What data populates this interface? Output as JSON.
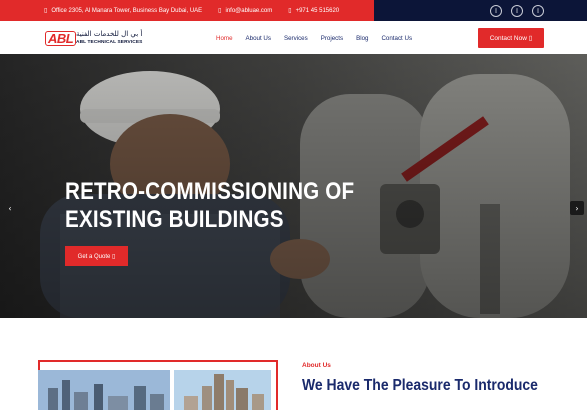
{
  "topbar": {
    "address": "Office 2305, Al Manara Tower, Business Bay Dubai, UAE",
    "email": "info@abluae.com",
    "phone": "+971 45 515620",
    "address_icon": "map-pin-icon",
    "email_icon": "envelope-icon",
    "phone_icon": "phone-icon",
    "social": [
      "facebook-icon",
      "linkedin-icon",
      "instagram-icon"
    ],
    "colors": {
      "left": "#e12a2a",
      "right": "#0c1538"
    }
  },
  "header": {
    "logo_mark": "ABL",
    "logo_arabic": "أ بي ال للخدمات الفنية",
    "logo_english": "ABL TECHNICAL SERVICES",
    "nav": [
      "Home",
      "About Us",
      "Services",
      "Projects",
      "Blog",
      "Contact Us"
    ],
    "active_nav": "Home",
    "cta_label": "Contact Now ▯"
  },
  "hero": {
    "title_line1": "RETRO-COMMISSIONING OF",
    "title_line2": "EXISTING BUILDINGS",
    "button_label": "Get a Quote ▯",
    "prev_icon": "chevron-left-icon",
    "next_icon": "chevron-right-icon"
  },
  "about": {
    "label": "About Us",
    "heading": "We Have The Pleasure To Introduce"
  },
  "colors": {
    "accent": "#e12a2a",
    "navy": "#1a2a6c"
  }
}
